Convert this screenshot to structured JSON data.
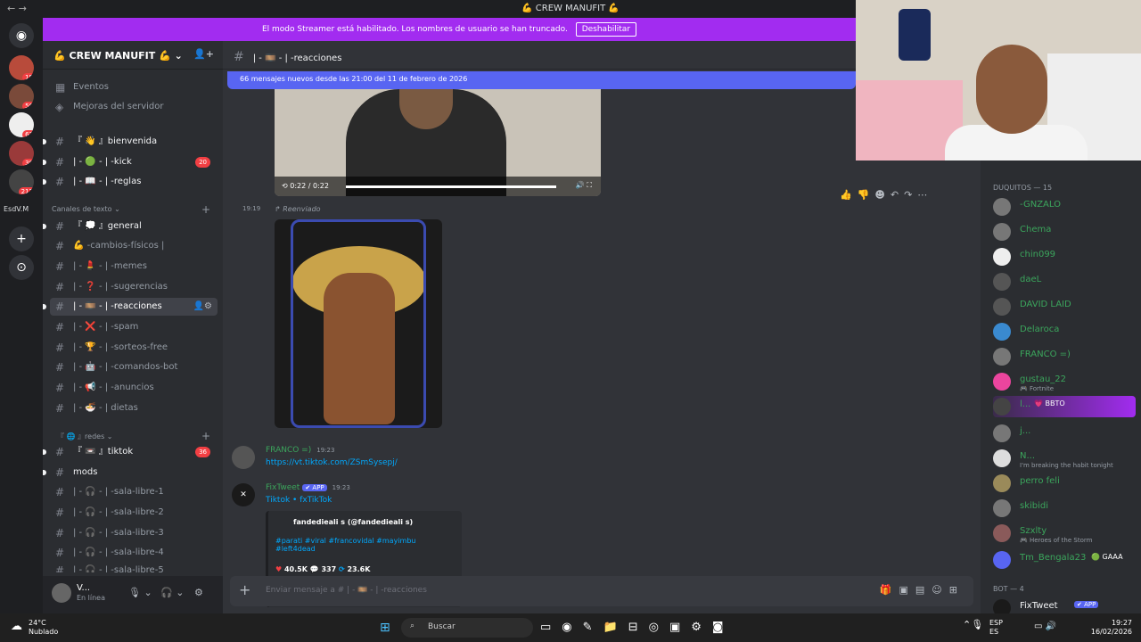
{
  "window": {
    "title": "💪 CREW MANUFIT 💪",
    "back": "←",
    "forward": "→"
  },
  "servers": [
    {
      "badge": "15"
    },
    {
      "badge": "56"
    },
    {
      "badge": "63"
    },
    {
      "badge": "30"
    },
    {
      "badge": "212"
    }
  ],
  "server_short": "EsdV.M",
  "streamer": {
    "text": "El modo Streamer está habilitado. Los nombres de usuario se han truncado.",
    "button": "Deshabilitar"
  },
  "guild": {
    "name": "💪 CREW MANUFIT 💪"
  },
  "sidebar": {
    "top": [
      "Eventos",
      "Mejoras del servidor"
    ],
    "channels": [
      {
        "name": "『 👋 』bienvenida",
        "badge": ""
      },
      {
        "name": "| - 🟢 - | -kick",
        "badge": "20"
      },
      {
        "name": "| - 📖 - | -reglas",
        "badge": ""
      }
    ],
    "cat_text": "Canales de texto",
    "text_channels": [
      "『 💭 』general",
      "💪 -cambios-físicos |",
      "| - 💄 - | -memes",
      "| - ❓ - | -sugerencias",
      "| - 🎞️ - | -reacciones",
      "| - ❌ - | -spam",
      "| - 🏆 - | -sorteos-free",
      "| - 🤖 - | -comandos-bot",
      "| - 📢 - | -anuncios",
      "| - 🍜 - | dietas"
    ],
    "cat_redes": "『 🌐 』redes",
    "redes": [
      {
        "name": "『 📼 』tiktok",
        "badge": "36"
      },
      {
        "name": "mods",
        "badge": ""
      }
    ],
    "voice": [
      "| - 🎧 - | -sala-libre-1",
      "| - 🎧 - | -sala-libre-2",
      "| - 🎧 - | -sala-libre-3",
      "| - 🎧 - | -sala-libre-4",
      "| - 🎧 - | -sala-libre-5"
    ]
  },
  "user": {
    "name": "V...",
    "status": "En línea"
  },
  "channel": {
    "title": "| - 🎞️ - | -reacciones",
    "new_messages": "66 mensajes nuevos desde las 21:00 del 11 de febrero de 2026"
  },
  "video1": {
    "time": "0:22 / 0:22"
  },
  "forward": {
    "time": "19:19",
    "label": "↱ Reenviado"
  },
  "messages": [
    {
      "author": "FRANCO =)",
      "time": "19:23",
      "body": "https://vt.tiktok.com/ZSmSysepj/"
    },
    {
      "author": "FixTweet",
      "badge": "✔ APP",
      "time": "19:23",
      "body": "Tiktok • fxTikTok"
    }
  ],
  "embed": {
    "author": "fandedieali s (@fandedieali s)",
    "tags": "#parati #viral #francovidal #mayimbu #left4dead",
    "likes": "40.5K",
    "comments": "337",
    "shares": "23.6K"
  },
  "composer": {
    "placeholder": "Enviar mensaje a # | - 🎞️ - | -reacciones"
  },
  "members": {
    "group1": "DUQUITOS — 15",
    "list": [
      {
        "name": "-GNZALO",
        "sub": ""
      },
      {
        "name": "Chema",
        "sub": ""
      },
      {
        "name": "chin099",
        "sub": ""
      },
      {
        "name": "daeL",
        "sub": ""
      },
      {
        "name": "DAVID LAID",
        "sub": ""
      },
      {
        "name": "Delaroca",
        "sub": ""
      },
      {
        "name": "FRANCO =)",
        "sub": ""
      },
      {
        "name": "gustau_22",
        "sub": "🎮 Fortnite"
      },
      {
        "name": "l...",
        "sub": "💗 BBTO"
      },
      {
        "name": "j...",
        "sub": ""
      },
      {
        "name": "N...",
        "sub": "I'm breaking the habit tonight"
      },
      {
        "name": "perro feli",
        "sub": ""
      },
      {
        "name": "skibidi",
        "sub": ""
      },
      {
        "name": "Szxlty",
        "sub": "🎮 Heroes of the Storm"
      },
      {
        "name": "Tm_Bengala23",
        "sub": "🟢 GAAA"
      }
    ],
    "group2": "BOT — 4",
    "bot": "FixTweet",
    "bot_badge": "✔ APP"
  },
  "taskbar": {
    "temp": "24°C",
    "weather": "Nublado",
    "search": "Buscar",
    "lang1": "ESP",
    "lang2": "ES",
    "time": "19:27",
    "date": "16/02/2026"
  }
}
